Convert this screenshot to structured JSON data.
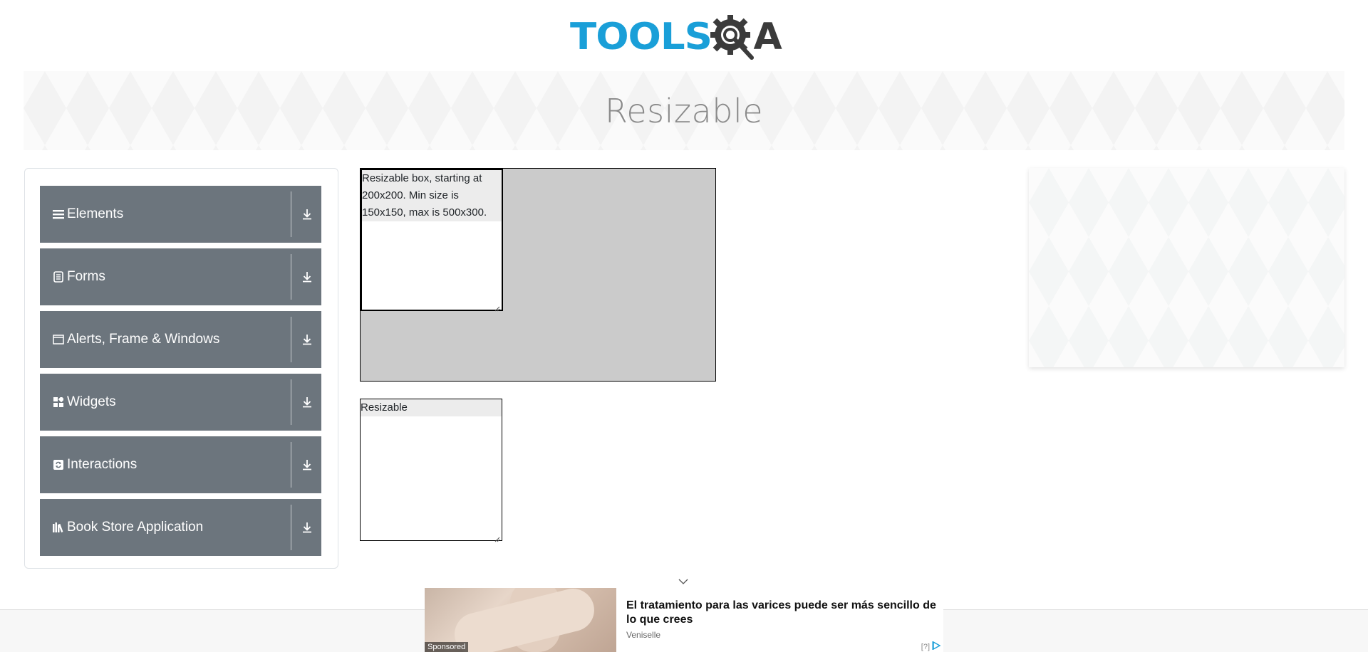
{
  "header": {
    "logo_text_tools": "TOOLS",
    "logo_text_qa_a": "A",
    "logo_text_qa_q": "Q"
  },
  "banner": {
    "title": "Resizable"
  },
  "sidebar": {
    "groups": [
      {
        "label": "Elements",
        "icon": "hamburger-icon"
      },
      {
        "label": "Forms",
        "icon": "form-icon"
      },
      {
        "label": "Alerts, Frame & Windows",
        "icon": "window-icon"
      },
      {
        "label": "Widgets",
        "icon": "widgets-icon"
      },
      {
        "label": "Interactions",
        "icon": "interactions-icon"
      },
      {
        "label": "Book Store Application",
        "icon": "books-icon"
      }
    ]
  },
  "main": {
    "restricted_box_text": "Resizable box, starting at 200x200. Min size is 150x150, max is 500x300.",
    "free_box_text": "Resizable"
  },
  "ad": {
    "title": "El tratamiento para las varices puede ser más sencillo de lo que crees",
    "brand": "Veniselle",
    "sponsored": "Sponsored",
    "info": "[?]"
  },
  "colors": {
    "accent": "#1a9fd8",
    "sidebar_group_bg": "#6c757d",
    "constraint_bg": "#cbcbcb"
  }
}
